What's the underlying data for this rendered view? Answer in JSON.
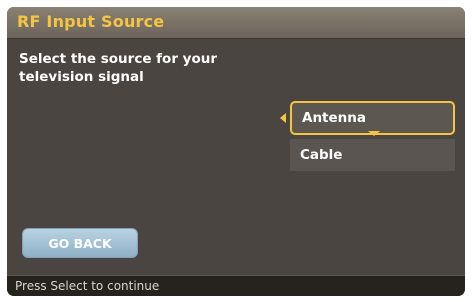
{
  "window": {
    "title": "RF Input Source"
  },
  "prompt": {
    "line1": "Select the source for your",
    "line2": "television signal"
  },
  "options": [
    {
      "label": "Antenna",
      "selected": true
    },
    {
      "label": "Cable",
      "selected": false
    }
  ],
  "buttons": {
    "go_back": "GO BACK"
  },
  "status": {
    "hint": "Press Select to continue"
  },
  "colors": {
    "accent": "#f5c542",
    "background": "#4a4540",
    "button": "#9fbfd3"
  },
  "icons": {
    "left": "left-arrow-icon",
    "down": "down-arrow-icon"
  }
}
